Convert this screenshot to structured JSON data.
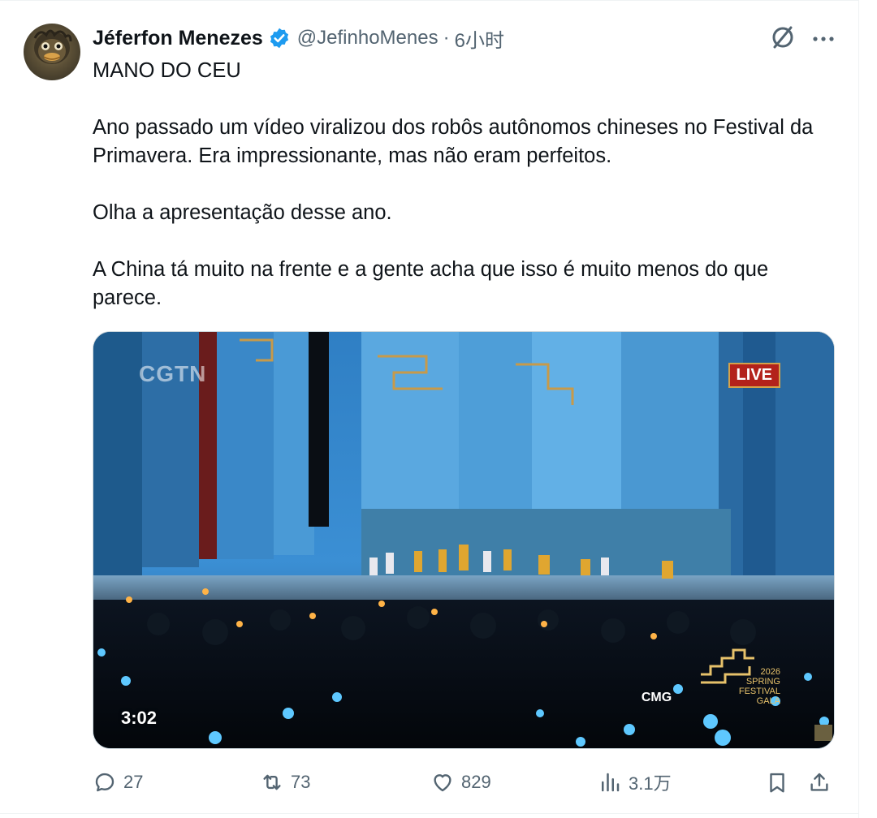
{
  "post": {
    "author": {
      "display_name": "Jéferfon Menezes",
      "handle": "@JefinhoMenes",
      "separator": "·",
      "time": "6小时",
      "verified": true
    },
    "text": {
      "line1": "MANO DO CEU",
      "para1": "Ano passado um vídeo viralizou dos robôs autônomos chineses no Festival da Primavera. Era impressionante, mas não eram perfeitos.",
      "para2": "Olha a apresentação desse ano.",
      "para3": "A China tá muito na frente e a gente acha que isso é muito menos do que parece."
    },
    "media": {
      "duration": "3:02",
      "overlay_live": "LIVE",
      "overlay_channel": "CGTN",
      "overlay_gala_line1": "2026",
      "overlay_gala_line2": "SPRING",
      "overlay_gala_line3": "FESTIVAL",
      "overlay_gala_line4": "GALA",
      "overlay_cmg": "CMG"
    },
    "actions": {
      "replies": "27",
      "reposts": "73",
      "likes": "829",
      "views": "3.1万"
    },
    "icons": {
      "verified": "verified-badge-icon",
      "grok": "grok-icon",
      "more": "more-icon",
      "reply": "reply-icon",
      "repost": "repost-icon",
      "like": "heart-icon",
      "views": "views-icon",
      "bookmark": "bookmark-icon",
      "share": "share-icon"
    },
    "colors": {
      "text_primary": "#0f1419",
      "text_secondary": "#536471",
      "verified_blue": "#1d9bf0",
      "border": "#eff3f4"
    }
  }
}
